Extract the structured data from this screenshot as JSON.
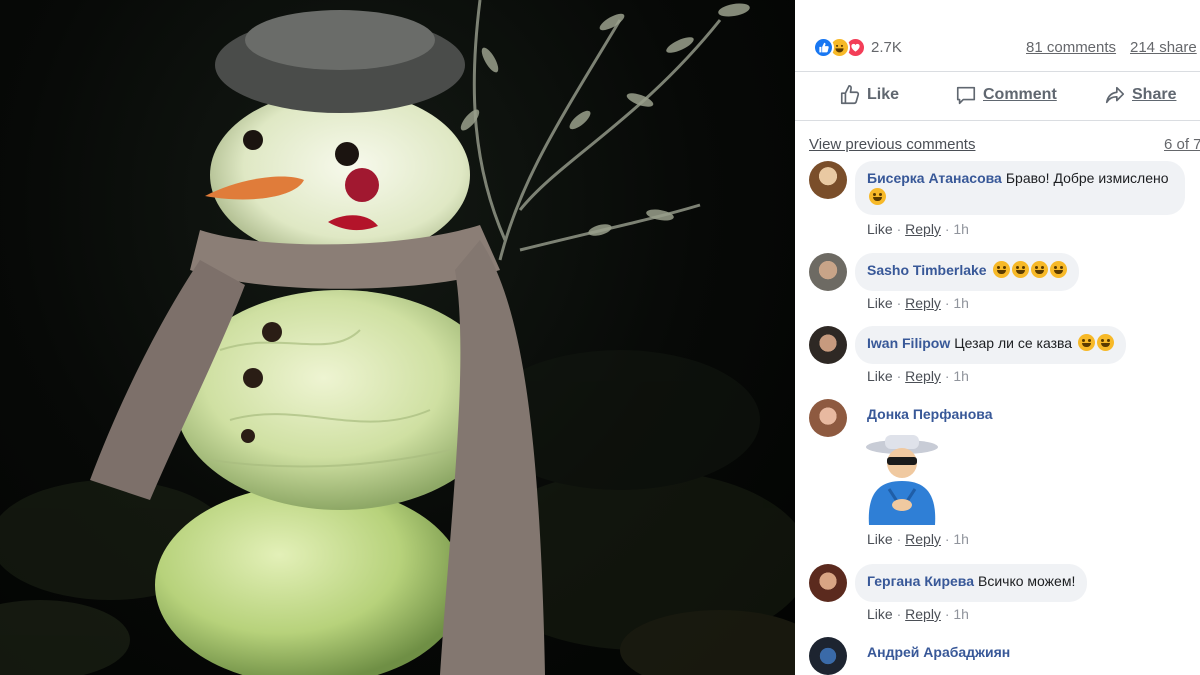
{
  "reactions": {
    "types": [
      "like",
      "haha",
      "love"
    ],
    "count": "2.7K",
    "comments_link": "81 comments",
    "shares_link": "214 share"
  },
  "actions": {
    "like": "Like",
    "comment": "Comment",
    "share": "Share"
  },
  "comments_section": {
    "view_previous": "View previous comments",
    "count": "6 of 7"
  },
  "comments": [
    {
      "author": "Биserka",
      "text": "",
      "time": "1h"
    }
  ],
  "list": [
    {
      "author": "Биcерка Атанасова",
      "text": "Браво! Добре измислено",
      "emoji": "smiling-face",
      "like": "Like",
      "reply": "Reply",
      "time": "1h"
    },
    {
      "author": "Sasho Timberlake",
      "text": "",
      "emoji": "rolling-laughing x4",
      "like": "Like",
      "reply": "Reply",
      "time": "1h"
    },
    {
      "author": "Iwan Filipow",
      "text": "Цезар ли се казва",
      "emoji": "grinning x2",
      "like": "Like",
      "reply": "Reply",
      "time": "1h"
    },
    {
      "author": "Донка Перфанова",
      "text": "",
      "emoji": "sticker-applauding-man",
      "like": "Like",
      "reply": "Reply",
      "time": "1h"
    },
    {
      "author": "Гергана Кирева",
      "text": "Всичко можем!",
      "emoji": "",
      "like": "Like",
      "reply": "Reply",
      "time": "1h"
    },
    {
      "author": "Андрей Арабаджиян",
      "text": "",
      "emoji": "",
      "like": "",
      "reply": "",
      "time": ""
    }
  ],
  "colors": {
    "link": "#385898",
    "bubble": "#f0f2f5",
    "like_blue": "#1877f2"
  }
}
